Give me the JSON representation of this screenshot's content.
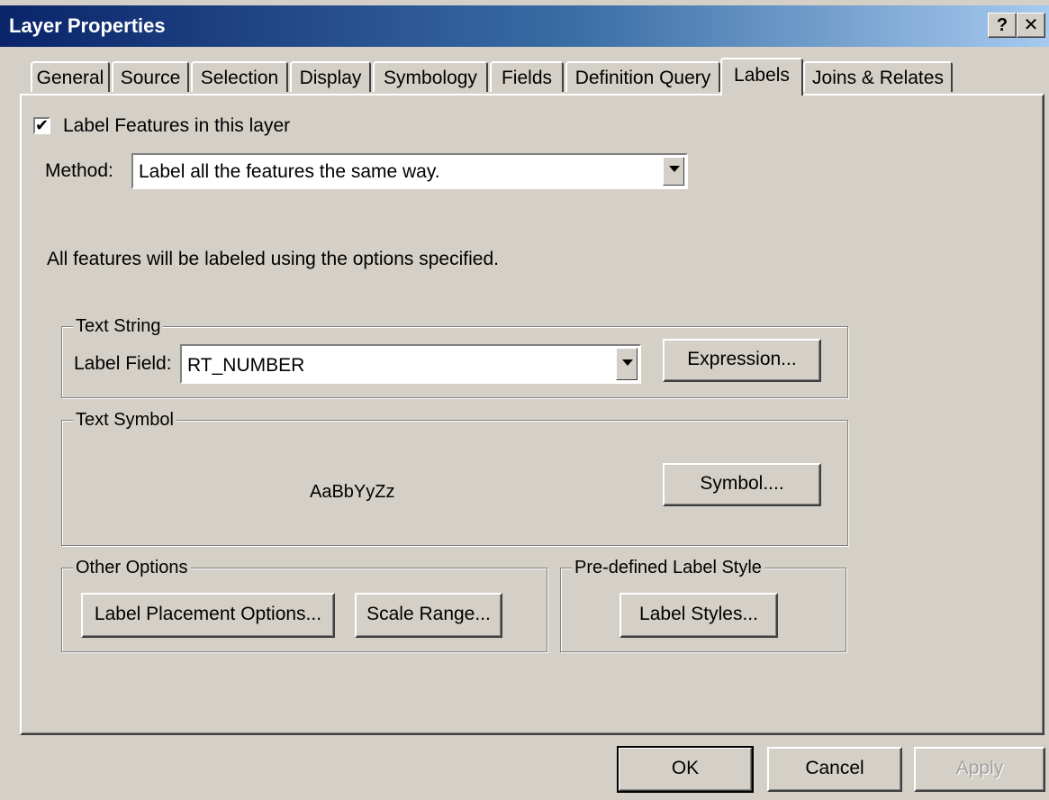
{
  "window": {
    "title": "Layer Properties",
    "help_label": "?",
    "close_label": "✕"
  },
  "tabs": [
    {
      "label": "General",
      "active": false
    },
    {
      "label": "Source",
      "active": false
    },
    {
      "label": "Selection",
      "active": false
    },
    {
      "label": "Display",
      "active": false
    },
    {
      "label": "Symbology",
      "active": false
    },
    {
      "label": "Fields",
      "active": false
    },
    {
      "label": "Definition Query",
      "active": false
    },
    {
      "label": "Labels",
      "active": true
    },
    {
      "label": "Joins & Relates",
      "active": false
    }
  ],
  "labels_tab": {
    "label_features_checkbox": {
      "label": "Label Features in this layer",
      "checked": true,
      "mark": "✔"
    },
    "method": {
      "label": "Method:",
      "value": "Label all the features the same way."
    },
    "description": "All features will be labeled using the options specified.",
    "text_string": {
      "title": "Text String",
      "label_field_label": "Label Field:",
      "label_field_value": "RT_NUMBER",
      "expression_button": "Expression..."
    },
    "text_symbol": {
      "title": "Text Symbol",
      "preview": "AaBbYyZz",
      "symbol_button": "Symbol...."
    },
    "other_options": {
      "title": "Other Options",
      "placement_button": "Label Placement Options...",
      "scale_range_button": "Scale Range..."
    },
    "predefined_style": {
      "title": "Pre-defined Label Style",
      "label_styles_button": "Label Styles..."
    }
  },
  "footer": {
    "ok": "OK",
    "cancel": "Cancel",
    "apply": "Apply"
  }
}
